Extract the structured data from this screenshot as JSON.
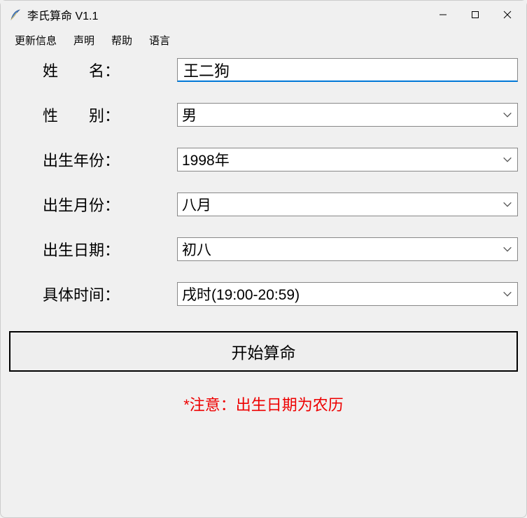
{
  "window": {
    "title": "李氏算命 V1.1"
  },
  "menu": {
    "update": "更新信息",
    "statement": "声明",
    "help": "帮助",
    "language": "语言"
  },
  "form": {
    "name_label": "姓　　名：",
    "name_value": "王二狗",
    "gender_label": "性　　别：",
    "gender_value": "男",
    "year_label": "出生年份：",
    "year_value": "1998年",
    "month_label": "出生月份：",
    "month_value": "八月",
    "day_label": "出生日期：",
    "day_value": "初八",
    "time_label": "具体时间：",
    "time_value": "戌时(19:00-20:59)"
  },
  "action": {
    "start_label": "开始算命"
  },
  "note": {
    "text": "*注意：出生日期为农历"
  }
}
